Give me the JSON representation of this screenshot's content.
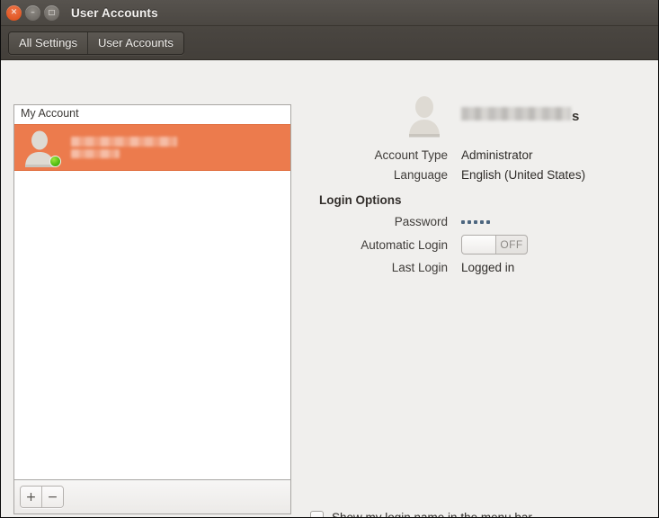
{
  "window": {
    "title": "User Accounts",
    "controls": [
      {
        "name": "close",
        "glyph": "✕"
      },
      {
        "name": "minimize",
        "glyph": "–"
      },
      {
        "name": "maximize",
        "glyph": "□"
      }
    ]
  },
  "toolbar": {
    "all_settings_label": "All Settings",
    "user_accounts_label": "User Accounts"
  },
  "users_list": {
    "header": "My Account",
    "selected_user": {
      "name_redacted": true,
      "status": "online"
    },
    "actions": {
      "add_label": "+",
      "remove_label": "−"
    }
  },
  "details": {
    "user_name_tail": "s",
    "rows": [
      {
        "label": "Account Type",
        "value": "Administrator"
      },
      {
        "label": "Language",
        "value": "English (United States)"
      }
    ],
    "login_options_header": "Login Options",
    "password": {
      "label": "Password",
      "dots": 5
    },
    "automatic_login": {
      "label": "Automatic Login",
      "state": "OFF",
      "on": false
    },
    "last_login": {
      "label": "Last Login",
      "value": "Logged in"
    }
  },
  "footer": {
    "show_login_name_label": "Show my login name in the menu bar",
    "show_login_name_checked": false
  },
  "colors": {
    "selection_orange": "#ec7b4d",
    "titlebar": "#4b4742",
    "background": "#f0efed",
    "status_green": "#55c016"
  }
}
